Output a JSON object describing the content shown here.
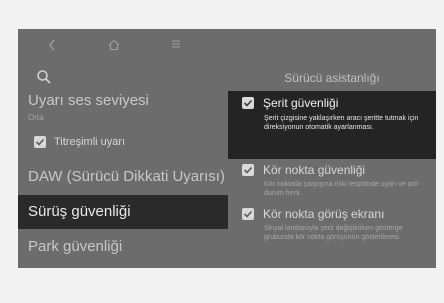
{
  "nav": {
    "back_icon": "chevron-left-icon",
    "home_icon": "home-icon",
    "menu_icon": "hamburger-menu-icon",
    "search_icon": "search-icon"
  },
  "left_menu": {
    "items": [
      {
        "label": "Uyarı ses seviyesi",
        "value": "Orta"
      },
      {
        "label": "Titreşimli uyarı"
      },
      {
        "label": "DAW (Sürücü Dikkati Uyarısı)"
      },
      {
        "label": "Sürüş güvenliği"
      },
      {
        "label": "Park güvenliği"
      }
    ]
  },
  "right_panel": {
    "title": "Sürücü asistanlığı",
    "options": [
      {
        "label": "Şerit güvenliği",
        "desc": "Şerit çizgisine yaklaşırken aracı şeritte tutmak için direksiyonun otomatik ayarlanması."
      },
      {
        "label": "Kör nokta güvenliği",
        "desc": "Kör noktada çarpışma riski tespitinde uyarı ve acil durum freni."
      },
      {
        "label": "Kör nokta görüş ekranı",
        "desc": "Sinyal lambasıyla şerit değiştirirken gösterge grubunda kör nokta görüşünün gösterilmesi."
      }
    ]
  },
  "colors": {
    "screen_bg": "#6c6c6c",
    "selected_bg": "#242424",
    "page_bg": "#f2f2f2"
  }
}
